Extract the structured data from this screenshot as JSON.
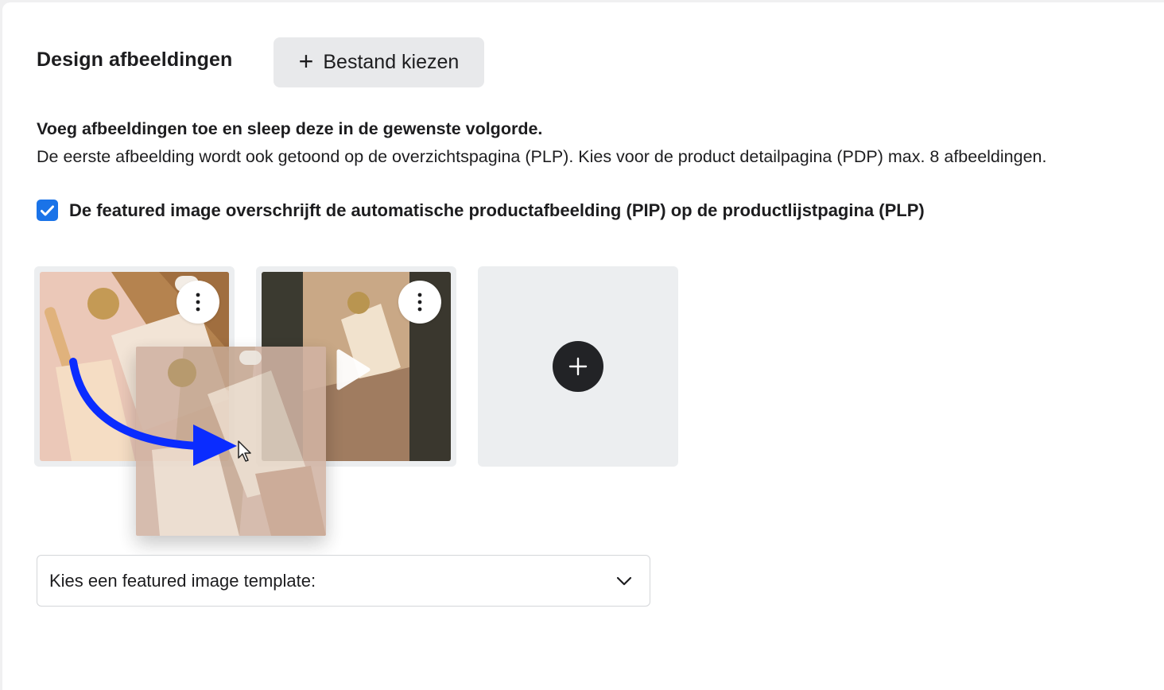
{
  "section": {
    "title": "Design afbeeldingen",
    "upload_button_label": "Bestand kiezen"
  },
  "instructions": {
    "bold": "Voeg afbeeldingen toe en sleep deze in de gewenste volgorde.",
    "text": "De eerste afbeelding wordt ook getoond op de overzichtspagina (PLP). Kies voor de product detailpagina (PDP) max. 8 afbeeldingen."
  },
  "featured_checkbox": {
    "checked": true,
    "label": "De featured image overschrijft de automatische productafbeelding (PIP) op de productlijstpagina (PLP)"
  },
  "images": [
    {
      "type": "image",
      "menu_icon": "more-vertical-icon"
    },
    {
      "type": "video",
      "menu_icon": "more-vertical-icon",
      "overlay_icon": "play-icon"
    }
  ],
  "add_tile": {
    "icon": "plus-icon"
  },
  "drag": {
    "active": true,
    "arrow_color": "#0a2cff"
  },
  "template_select": {
    "label": "Kies een featured image template:",
    "icon": "chevron-down-icon"
  },
  "colors": {
    "accent": "#1a73e8",
    "tile_bg": "#eceef0",
    "add_button": "#222326"
  }
}
